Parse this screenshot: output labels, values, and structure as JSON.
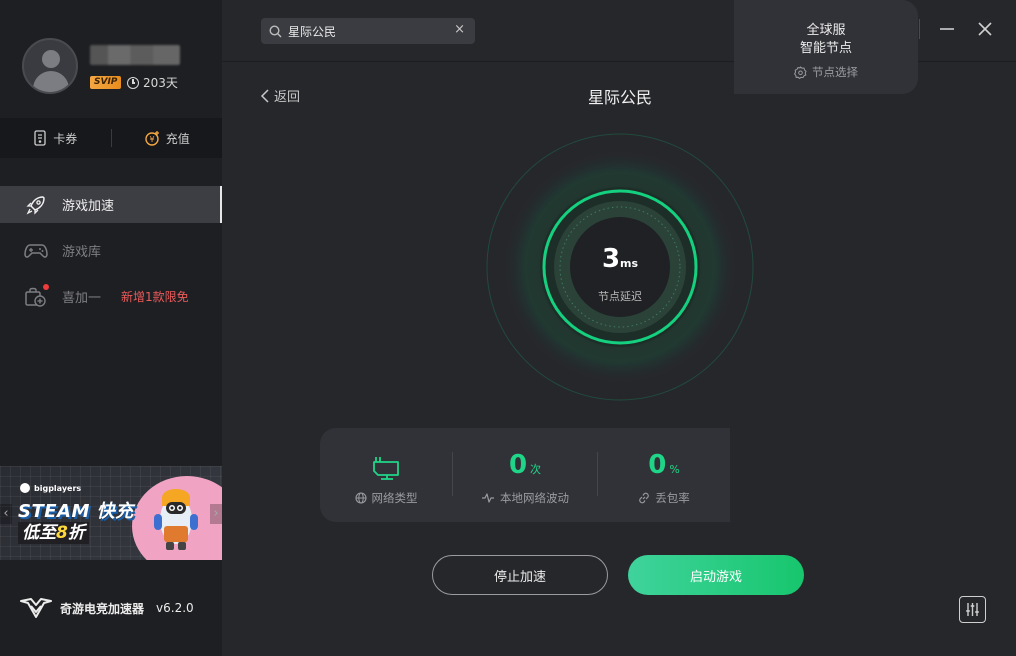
{
  "profile": {
    "badge": "SVIP",
    "days": "203天"
  },
  "wallet": {
    "coupon_label": "卡券",
    "recharge_label": "充值"
  },
  "nav": {
    "items": [
      {
        "label": "游戏加速"
      },
      {
        "label": "游戏库"
      },
      {
        "label": "喜加一",
        "badge": "新增1款限免"
      }
    ]
  },
  "banner": {
    "brand": "bigplayers",
    "title": "STEAM 快充",
    "sub_prefix": "低至",
    "sub_number": "8",
    "sub_suffix": "折",
    "prev": "‹",
    "next": "›"
  },
  "footer": {
    "app_name": "奇游电竞加速器",
    "version": "v6.2.0"
  },
  "search": {
    "value": "星际公民",
    "clear": "×"
  },
  "main": {
    "back_label": "返回",
    "game_title": "星际公民",
    "latency": {
      "value": "3",
      "unit": "ms",
      "label": "节点延迟"
    },
    "stats": {
      "network_type_label": "网络类型",
      "fluctuation": {
        "value": "0",
        "unit": "次",
        "label": "本地网络波动"
      },
      "packet_loss": {
        "value": "0",
        "unit": "%",
        "label": "丢包率"
      }
    },
    "node": {
      "line1": "全球服",
      "line2": "智能节点",
      "label": "节点选择"
    },
    "stop_label": "停止加速",
    "start_label": "启动游戏"
  },
  "colors": {
    "accent": "#1fd688",
    "badge_red": "#ec5b5b",
    "svip": "#f5a742"
  }
}
